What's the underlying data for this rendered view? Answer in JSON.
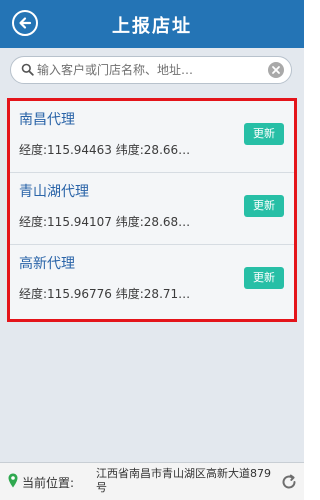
{
  "header": {
    "title": "上报店址"
  },
  "search": {
    "placeholder": "输入客户或门店名称、地址…"
  },
  "stores": [
    {
      "name": "南昌代理",
      "coords": "经度:115.94463 纬度:28.66…",
      "action": "更新"
    },
    {
      "name": "青山湖代理",
      "coords": "经度:115.94107 纬度:28.68…",
      "action": "更新"
    },
    {
      "name": "高新代理",
      "coords": "经度:115.96776 纬度:28.71…",
      "action": "更新"
    }
  ],
  "footer": {
    "location_label": "当前位置:",
    "location_value": "江西省南昌市青山湖区高新大道879号"
  },
  "colors": {
    "header_bg": "#2474b5",
    "highlight_border": "#e4141a",
    "update_button": "#27bfa6",
    "store_name": "#2a64a8"
  }
}
